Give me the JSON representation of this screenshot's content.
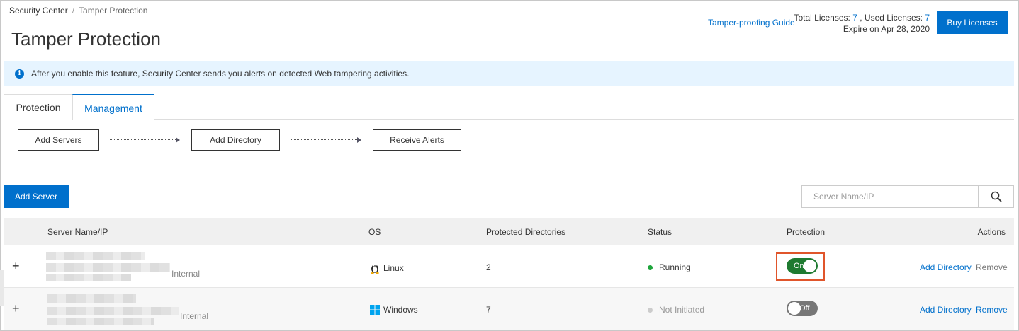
{
  "breadcrumb": {
    "root": "Security Center",
    "separator": "/",
    "current": "Tamper Protection"
  },
  "page_title": "Tamper Protection",
  "header": {
    "guide_link": "Tamper-proofing Guide",
    "total_licenses_label": "Total Licenses:",
    "total_licenses_value": "7",
    "used_licenses_label": ", Used Licenses:",
    "used_licenses_value": "7",
    "expire_text": "Expire on Apr 28, 2020",
    "buy_button": "Buy Licenses"
  },
  "alert": {
    "text": "After you enable this feature, Security Center sends you alerts on detected Web tampering activities."
  },
  "tabs": [
    {
      "label": "Protection"
    },
    {
      "label": "Management"
    }
  ],
  "steps": [
    "Add Servers",
    "Add Directory",
    "Receive Alerts"
  ],
  "toolbar": {
    "add_server": "Add Server",
    "search_placeholder": "Server Name/IP"
  },
  "table": {
    "columns": [
      "Server Name/IP",
      "OS",
      "Protected Directories",
      "Status",
      "Protection",
      "Actions"
    ],
    "rows": [
      {
        "tag": "Internal",
        "os": "Linux",
        "os_icon": "linux-icon",
        "protected_dirs": "2",
        "status": "Running",
        "status_color": "#1ea53c",
        "protection_label": "On",
        "action_add": "Add Directory",
        "action_remove": "Remove"
      },
      {
        "tag": "Internal",
        "os": "Windows",
        "os_icon": "windows-icon",
        "protected_dirs": "7",
        "status": "Not Initiated",
        "status_color": "#cccccc",
        "protection_label": "Off",
        "action_add": "Add Directory",
        "action_remove": "Remove"
      }
    ]
  },
  "colors": {
    "accent": "#0070cc",
    "toggle_on": "#1e7a30",
    "highlight": "#e0552b"
  }
}
